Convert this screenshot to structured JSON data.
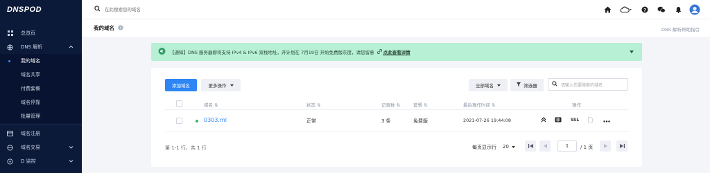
{
  "brand": {
    "logo": "DNSPOD"
  },
  "sidebar": {
    "items": [
      {
        "label": "总览页"
      },
      {
        "label": "DNS 解析"
      },
      {
        "label": "域名注册"
      },
      {
        "label": "域名交易"
      },
      {
        "label": "D 监控"
      }
    ],
    "sub_items": [
      {
        "label": "我的域名"
      },
      {
        "label": "域名共享"
      },
      {
        "label": "付费套餐"
      },
      {
        "label": "域名停靠"
      },
      {
        "label": "批量管理"
      }
    ]
  },
  "topbar": {
    "search_placeholder": "在此搜索您的域名"
  },
  "page": {
    "title": "我的域名",
    "help_link": "DNS 解析帮助指引"
  },
  "notice": {
    "text": "【通知】DNS 服务器即将支持 IPv4 & IPv6 双栈地址，开计划在 7月19日 开始免费版灰度，请您留意",
    "link": "点此查看详情"
  },
  "toolbar": {
    "add_domain": "添加域名",
    "more_actions": "更多操作",
    "all_domains": "全部域名",
    "filter": "筛选器",
    "search_placeholder": "请输入您要搜索的域名"
  },
  "table": {
    "headers": {
      "name": "域名",
      "status": "状态",
      "records": "记录数",
      "plan": "套餐",
      "last_op": "最后操作时间",
      "actions": "操作"
    },
    "rows": [
      {
        "domain": "0303.ml",
        "status": "正常",
        "records": "3 条",
        "plan": "免费版",
        "last_op": "2021-07-26 19:44:08",
        "ssl": "SSL"
      }
    ]
  },
  "pagination": {
    "summary": "第 1-1 行，共 1 行",
    "per_page_label": "每页显示行",
    "per_page": "20",
    "current_page": "1",
    "total_pages": "/ 1 页"
  },
  "colors": {
    "sidebar": "#0c1a3a",
    "primary": "#2e86f5",
    "notice_bg": "#b7f0d5",
    "status_ok": "#2bb673"
  }
}
